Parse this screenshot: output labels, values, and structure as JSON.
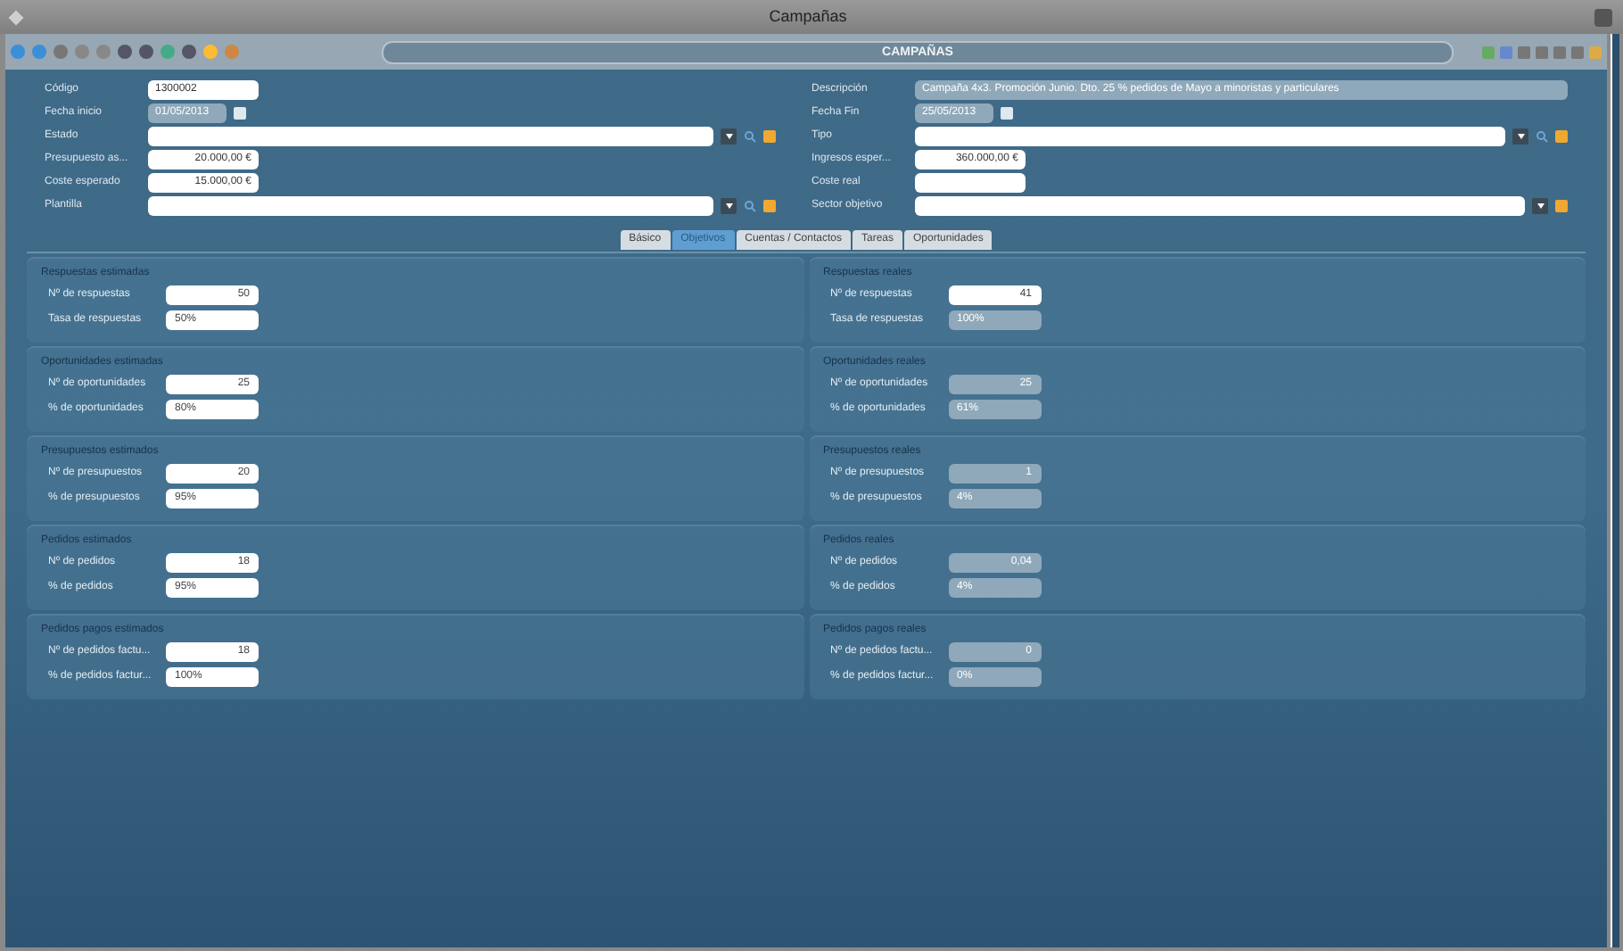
{
  "window": {
    "title": "Campañas"
  },
  "header": {
    "title": "CAMPAÑAS"
  },
  "form_left": [
    {
      "label": "Código",
      "value": "1300002",
      "kind": "short",
      "disabled": false
    },
    {
      "label": "Fecha inicio",
      "value": "01/05/2013",
      "kind": "date",
      "disabled": true
    },
    {
      "label": "Estado",
      "kind": "combo",
      "disabled": false
    },
    {
      "label": "Presupuesto as...",
      "value": "20.000,00 €",
      "kind": "amount",
      "disabled": false
    },
    {
      "label": "Coste esperado",
      "value": "15.000,00 €",
      "kind": "amount",
      "disabled": false
    },
    {
      "label": "Plantilla",
      "kind": "combo",
      "disabled": false
    }
  ],
  "form_right": [
    {
      "label": "Descripción",
      "value": "Campaña 4x3. Promoción Junio. Dto. 25 % pedidos de Mayo a minoristas y particulares",
      "kind": "long",
      "disabled": true
    },
    {
      "label": "Fecha Fin",
      "value": "25/05/2013",
      "kind": "date",
      "disabled": true
    },
    {
      "label": "Tipo",
      "kind": "combo",
      "disabled": false
    },
    {
      "label": "Ingresos esper...",
      "value": "360.000,00 €",
      "kind": "amount",
      "disabled": false
    },
    {
      "label": "Coste real",
      "kind": "amount",
      "disabled": false
    },
    {
      "label": "Sector objetivo",
      "kind": "combo_noseek",
      "disabled": false
    }
  ],
  "tabs": [
    {
      "label": "Básico",
      "selected": false
    },
    {
      "label": "Objetivos",
      "selected": true
    },
    {
      "label": "Cuentas / Contactos",
      "selected": false
    },
    {
      "label": "Tareas",
      "selected": false
    },
    {
      "label": "Oportunidades",
      "selected": false
    }
  ],
  "sections": [
    {
      "left": {
        "title": "Respuestas estimadas",
        "rows": [
          {
            "label": "Nº de respuestas",
            "value": "50",
            "disabled": false
          },
          {
            "label": "Tasa de respuestas",
            "value": "50%",
            "disabled": false
          }
        ]
      },
      "right": {
        "title": "Respuestas reales",
        "rows": [
          {
            "label": "Nº de respuestas",
            "value": "41",
            "disabled": false
          },
          {
            "label": "Tasa de respuestas",
            "value": "100%",
            "disabled": true
          }
        ]
      }
    },
    {
      "left": {
        "title": "Oportunidades estimadas",
        "rows": [
          {
            "label": "Nº de oportunidades",
            "value": "25",
            "disabled": false
          },
          {
            "label": "% de oportunidades",
            "value": "80%",
            "disabled": false
          }
        ]
      },
      "right": {
        "title": "Oportunidades reales",
        "rows": [
          {
            "label": "Nº de oportunidades",
            "value": "25",
            "disabled": true
          },
          {
            "label": "% de oportunidades",
            "value": "61%",
            "disabled": true
          }
        ]
      }
    },
    {
      "left": {
        "title": "Presupuestos estimados",
        "rows": [
          {
            "label": "Nº de presupuestos",
            "value": "20",
            "disabled": false
          },
          {
            "label": "% de presupuestos",
            "value": "95%",
            "disabled": false
          }
        ]
      },
      "right": {
        "title": "Presupuestos reales",
        "rows": [
          {
            "label": "Nº de presupuestos",
            "value": "1",
            "disabled": true
          },
          {
            "label": "% de presupuestos",
            "value": "4%",
            "disabled": true
          }
        ]
      }
    },
    {
      "left": {
        "title": "Pedidos estimados",
        "rows": [
          {
            "label": "Nº de pedidos",
            "value": "18",
            "disabled": false
          },
          {
            "label": "% de pedidos",
            "value": "95%",
            "disabled": false
          }
        ]
      },
      "right": {
        "title": "Pedidos reales",
        "rows": [
          {
            "label": "Nº de pedidos",
            "value": "0,04",
            "disabled": true
          },
          {
            "label": "% de pedidos",
            "value": "4%",
            "disabled": true
          }
        ]
      }
    },
    {
      "left": {
        "title": "Pedidos pagos estimados",
        "rows": [
          {
            "label": "Nº de pedidos factu...",
            "value": "18",
            "disabled": false
          },
          {
            "label": "% de pedidos factur...",
            "value": "100%",
            "disabled": false
          }
        ]
      },
      "right": {
        "title": "Pedidos pagos reales",
        "rows": [
          {
            "label": "Nº de pedidos factu...",
            "value": "0",
            "disabled": true
          },
          {
            "label": "% de pedidos factur...",
            "value": "0%",
            "disabled": true
          }
        ]
      }
    }
  ]
}
